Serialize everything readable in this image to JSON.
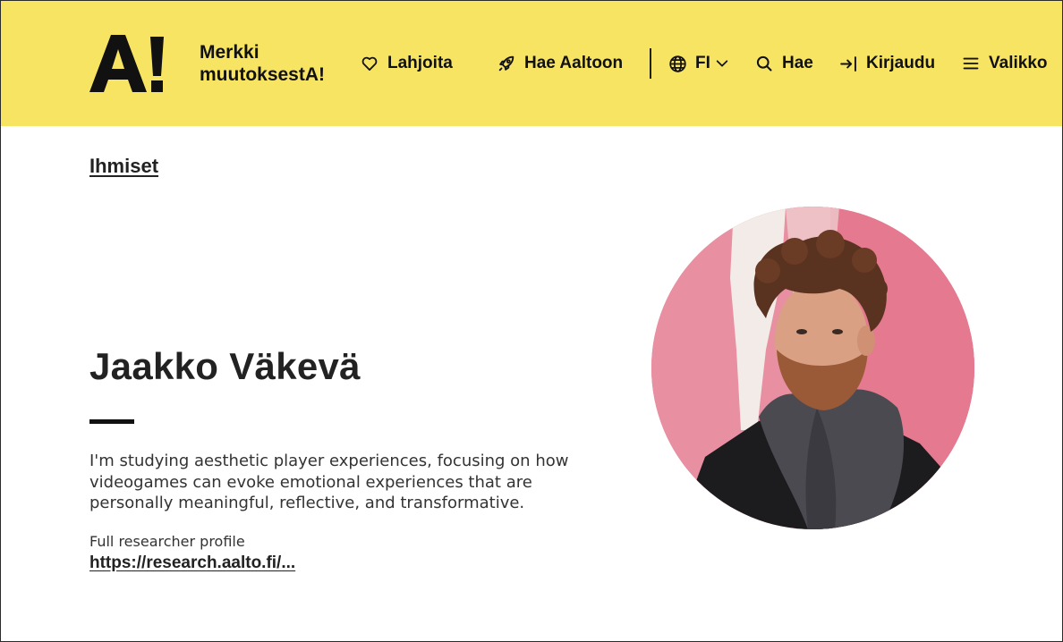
{
  "header": {
    "logo_text": "A!",
    "slogan_line1": "Merkki",
    "slogan_line2": "muutoksestA!",
    "nav": {
      "donate": "Lahjoita",
      "apply": "Hae Aaltoon",
      "language": "FI",
      "search": "Hae",
      "login": "Kirjaudu",
      "menu": "Valikko"
    }
  },
  "breadcrumb": "Ihmiset",
  "profile": {
    "name": "Jaakko Väkevä",
    "bio": "I'm studying aesthetic player experiences, focusing on how videogames can evoke emotional experiences that are personally meaningful, reflective, and transformative.",
    "researcher_label": "Full researcher profile",
    "researcher_link": "https://research.aalto.fi/..."
  },
  "colors": {
    "header_bg": "#f8e463",
    "text": "#222222",
    "portrait_bg": "#e7859b"
  },
  "icons": [
    "heart-icon",
    "rocket-icon",
    "globe-icon",
    "chevron-down-icon",
    "search-icon",
    "login-icon",
    "menu-icon"
  ]
}
